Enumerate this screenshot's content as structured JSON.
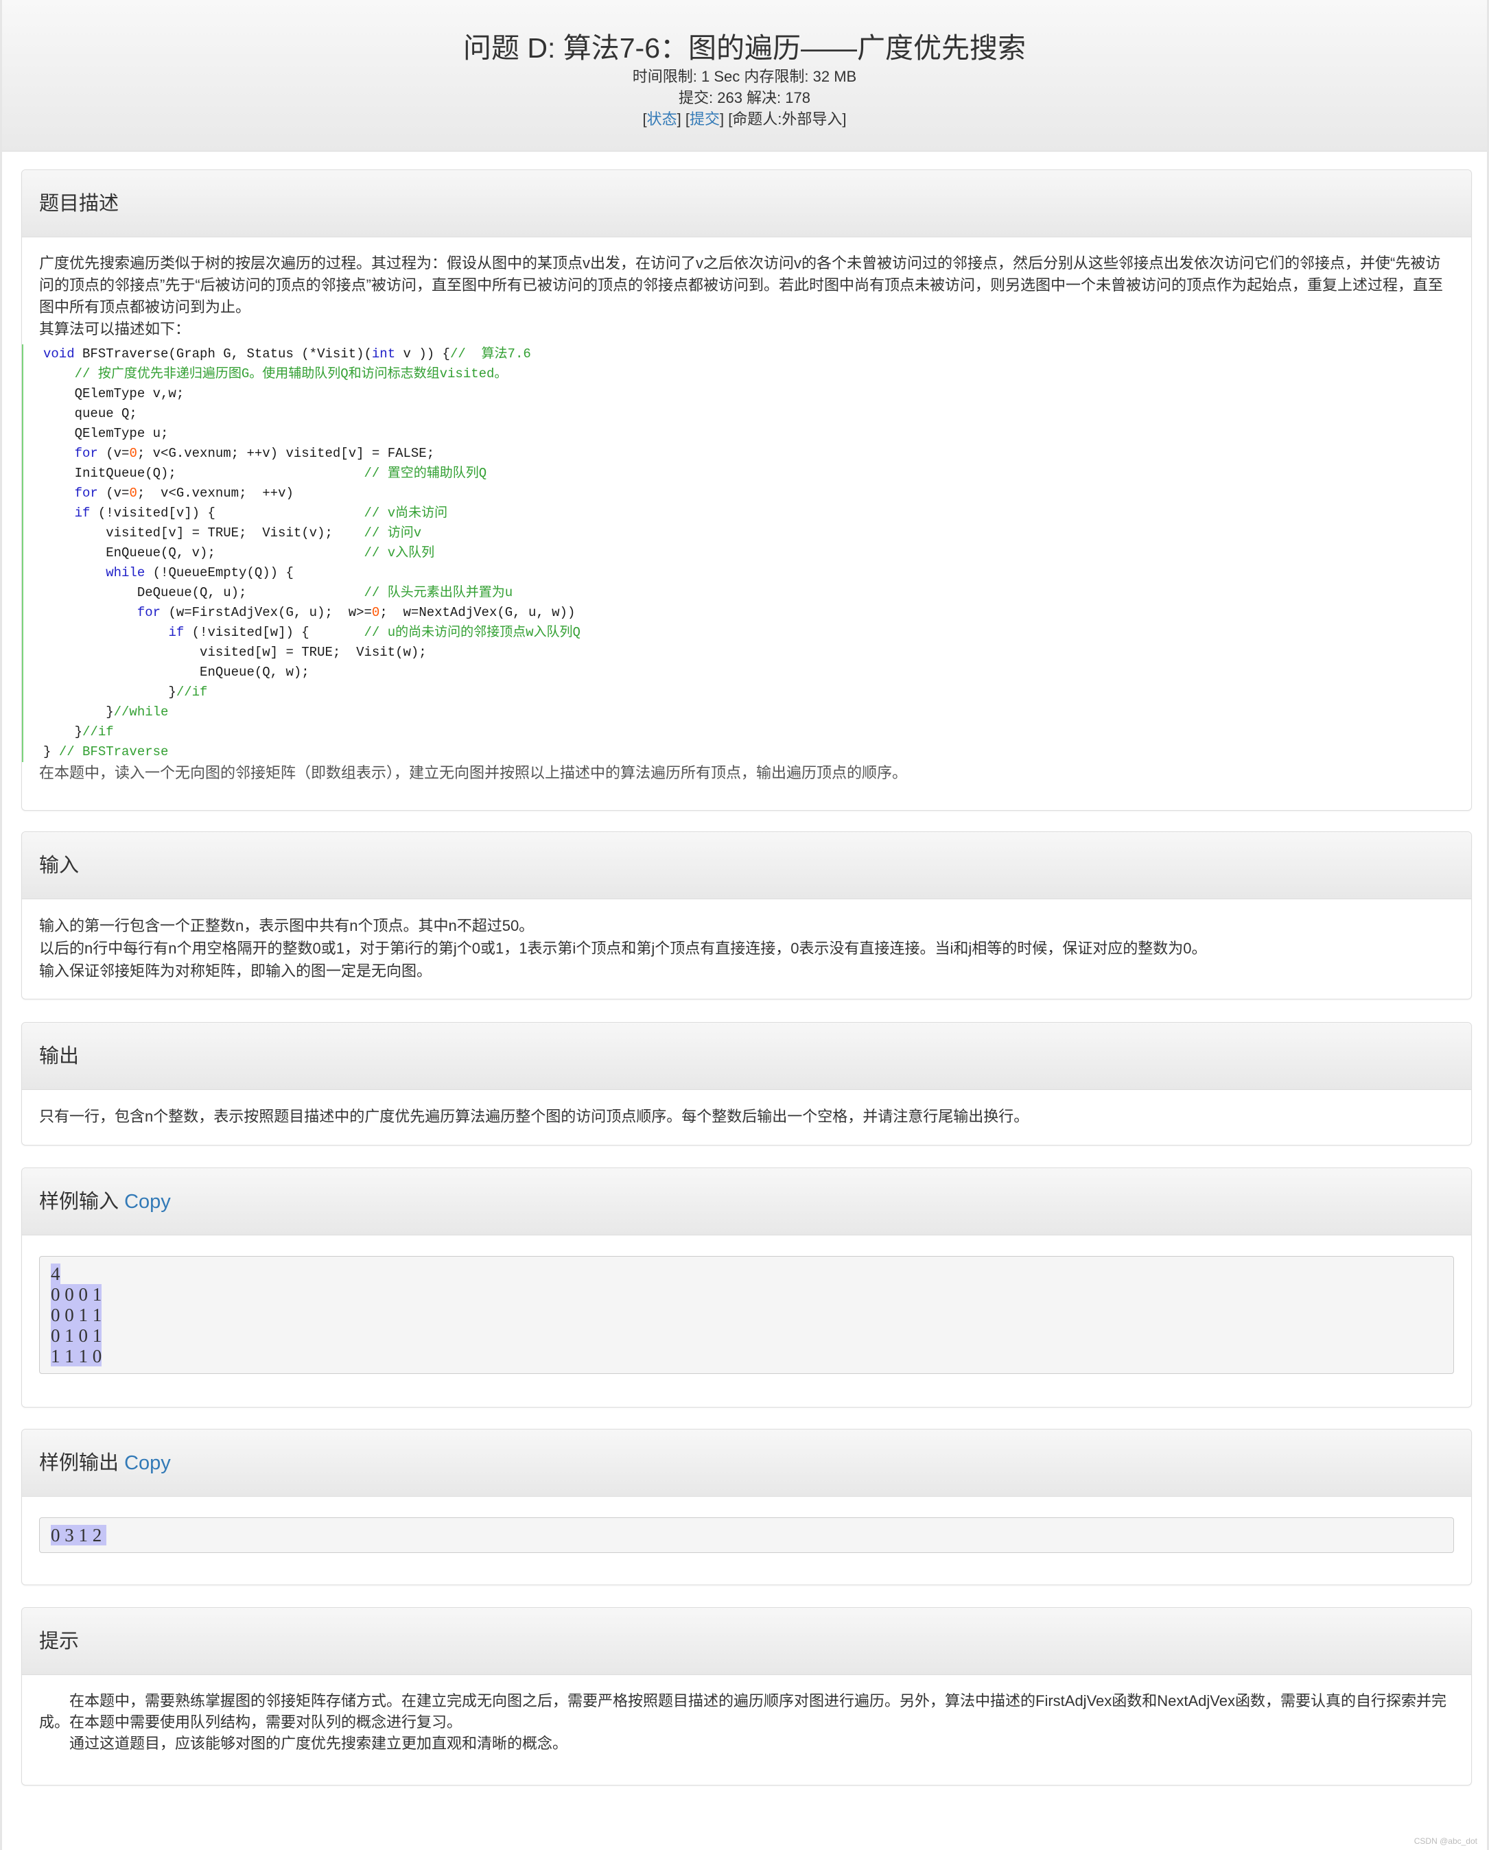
{
  "header": {
    "title": "问题 D: 算法7-6：图的遍历——广度优先搜索",
    "limits": "时间限制: 1 Sec  内存限制: 32 MB",
    "stats": "提交: 263  解决: 178",
    "status_link": "状态",
    "submit_link": "提交",
    "author": "[命题人:外部导入]"
  },
  "description": {
    "heading": "题目描述",
    "para1": "广度优先搜索遍历类似于树的按层次遍历的过程。其过程为：假设从图中的某顶点v出发，在访问了v之后依次访问v的各个未曾被访问过的邻接点，然后分别从这些邻接点出发依次访问它们的邻接点，并使“先被访问的顶点的邻接点”先于“后被访问的顶点的邻接点”被访问，直至图中所有已被访问的顶点的邻接点都被访问到。若此时图中尚有顶点未被访问，则另选图中一个未曾被访问的顶点作为起始点，重复上述过程，直至图中所有顶点都被访问到为止。",
    "para2": "其算法可以描述如下：",
    "code_lines": [
      "void BFSTraverse(Graph G, Status (*Visit)(int v )) {//  算法7.6",
      "    // 按广度优先非递归遍历图G。使用辅助队列Q和访问标志数组visited。",
      "    QElemType v,w;",
      "    queue Q;",
      "    QElemType u;",
      "    for (v=0; v<G.vexnum; ++v) visited[v] = FALSE;",
      "    InitQueue(Q);                        // 置空的辅助队列Q",
      "    for (v=0;  v<G.vexnum;  ++v)",
      "    if (!visited[v]) {                   // v尚未访问",
      "        visited[v] = TRUE;  Visit(v);    // 访问v",
      "        EnQueue(Q, v);                   // v入队列",
      "        while (!QueueEmpty(Q)) {",
      "            DeQueue(Q, u);               // 队头元素出队并置为u",
      "            for (w=FirstAdjVex(G, u);  w>=0;  w=NextAdjVex(G, u, w))",
      "                if (!visited[w]) {       // u的尚未访问的邻接顶点w入队列Q",
      "                    visited[w] = TRUE;  Visit(w);",
      "                    EnQueue(Q, w);",
      "                }//if",
      "        }//while",
      "    }//if",
      "} // BFSTraverse"
    ],
    "para3": "在本题中，读入一个无向图的邻接矩阵（即数组表示），建立无向图并按照以上描述中的算法遍历所有顶点，输出遍历顶点的顺序。"
  },
  "input": {
    "heading": "输入",
    "lines": [
      "输入的第一行包含一个正整数n，表示图中共有n个顶点。其中n不超过50。",
      "以后的n行中每行有n个用空格隔开的整数0或1，对于第i行的第j个0或1，1表示第i个顶点和第j个顶点有直接连接，0表示没有直接连接。当i和j相等的时候，保证对应的整数为0。",
      "输入保证邻接矩阵为对称矩阵，即输入的图一定是无向图。"
    ]
  },
  "output": {
    "heading": "输出",
    "text": "只有一行，包含n个整数，表示按照题目描述中的广度优先遍历算法遍历整个图的访问顶点顺序。每个整数后输出一个空格，并请注意行尾输出换行。"
  },
  "sample_input": {
    "heading": "样例输入",
    "copy": "Copy",
    "lines": [
      "4",
      "0 0 0 1",
      "0 0 1 1",
      "0 1 0 1",
      "1 1 1 0"
    ]
  },
  "sample_output": {
    "heading": "样例输出",
    "copy": "Copy",
    "lines": [
      "0 3 1 2 "
    ]
  },
  "hint": {
    "heading": "提示",
    "para1": "在本题中，需要熟练掌握图的邻接矩阵存储方式。在建立完成无向图之后，需要严格按照题目描述的遍历顺序对图进行遍历。另外，算法中描述的FirstAdjVex函数和NextAdjVex函数，需要认真的自行探索并完成。在本题中需要使用队列结构，需要对队列的概念进行复习。",
    "para2": "通过这道题目，应该能够对图的广度优先搜索建立更加直观和清晰的概念。"
  },
  "watermark": "CSDN @abc_dot",
  "colors": {
    "link": "#337ab7",
    "keyword": "#2020c8",
    "comment": "#33a033",
    "number": "#ff5500",
    "selection": "#c5c5f6"
  }
}
